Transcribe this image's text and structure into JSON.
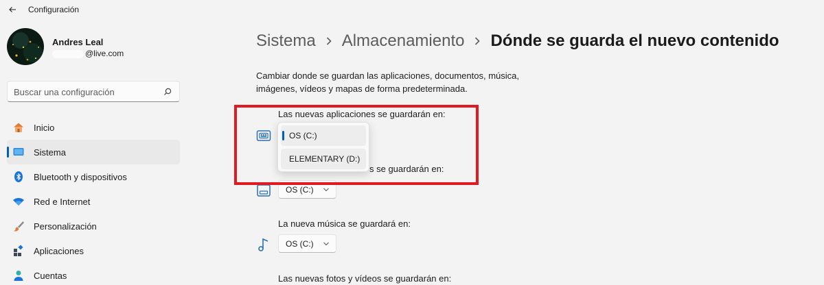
{
  "app": {
    "title": "Configuración"
  },
  "profile": {
    "name": "Andres Leal",
    "email_suffix": "@live.com"
  },
  "search": {
    "placeholder": "Buscar una configuración"
  },
  "nav": {
    "items": [
      {
        "label": "Inicio",
        "icon": "home-icon"
      },
      {
        "label": "Sistema",
        "icon": "system-icon",
        "active": true
      },
      {
        "label": "Bluetooth y dispositivos",
        "icon": "bluetooth-icon"
      },
      {
        "label": "Red e Internet",
        "icon": "wifi-icon"
      },
      {
        "label": "Personalización",
        "icon": "brush-icon"
      },
      {
        "label": "Aplicaciones",
        "icon": "apps-icon"
      },
      {
        "label": "Cuentas",
        "icon": "account-icon"
      }
    ]
  },
  "breadcrumb": {
    "items": [
      "Sistema",
      "Almacenamiento"
    ],
    "current": "Dónde se guarda el nuevo contenido"
  },
  "description": "Cambiar donde se guardan las aplicaciones, documentos, música, imágenes, vídeos y mapas de forma predeterminada.",
  "settings": {
    "apps": {
      "label": "Las nuevas aplicaciones se guardarán en:",
      "icon": "app-storage-icon"
    },
    "documents": {
      "label_visible": "s se guardarán en:",
      "value": "OS (C:)",
      "icon": "document-storage-icon"
    },
    "music": {
      "label": "La nueva música se guardará en:",
      "value": "OS (C:)",
      "icon": "music-icon"
    },
    "photos": {
      "label": "Las nuevas fotos y vídeos se guardarán en:"
    }
  },
  "flyout": {
    "options": [
      {
        "label": "OS (C:)",
        "selected": true
      },
      {
        "label": "ELEMENTARY (D:)",
        "selected": false
      }
    ]
  },
  "colors": {
    "accent": "#005fb8",
    "highlight": "#e01a22",
    "background": "#f3f3f3"
  }
}
